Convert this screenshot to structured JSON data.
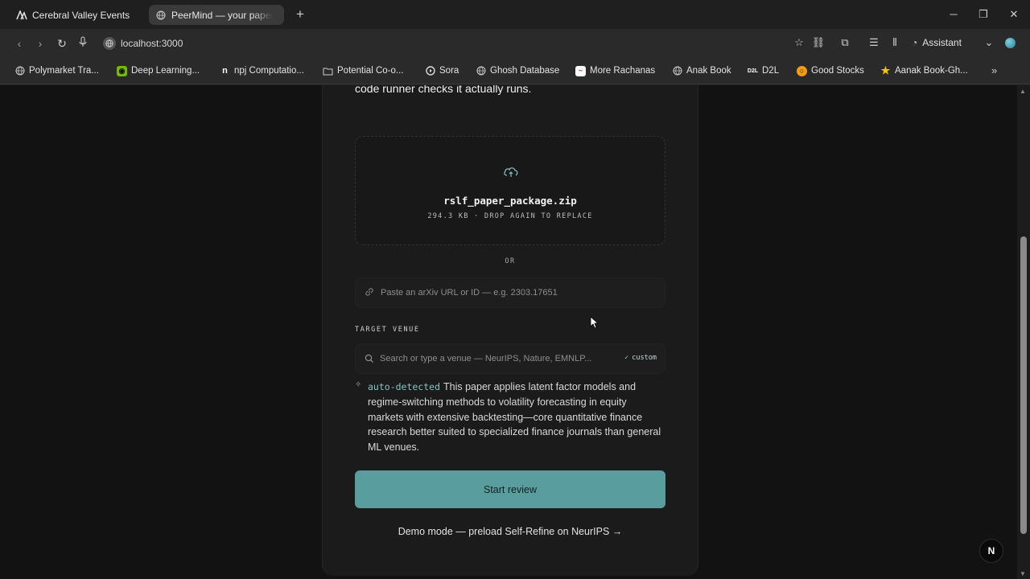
{
  "browser": {
    "tabs": [
      {
        "label": "Cerebral Valley Events",
        "icon": "cerebral-valley-icon"
      },
      {
        "label": "PeerMind — your paper's",
        "icon": "globe-icon"
      }
    ],
    "url": "localhost:3000",
    "assistant_label": "Assistant",
    "bookmarks": [
      {
        "label": "Polymarket Tra...",
        "icon": "globe-icon"
      },
      {
        "label": "Deep Learning...",
        "icon": "nvidia-icon"
      },
      {
        "label": "npj Computatio...",
        "icon": "n-icon"
      },
      {
        "label": "Potential Co-o...",
        "icon": "folder-icon"
      },
      {
        "label": "Sora",
        "icon": "sora-icon"
      },
      {
        "label": "Ghosh Database",
        "icon": "globe-icon"
      },
      {
        "label": "More Rachanas",
        "icon": "rachana-icon"
      },
      {
        "label": "Anak Book",
        "icon": "globe-icon"
      },
      {
        "label": "D2L",
        "icon": "d2l-icon"
      },
      {
        "label": "Good Stocks",
        "icon": "stocks-icon"
      },
      {
        "label": "Aanak Book-Gh...",
        "icon": "star-icon"
      }
    ]
  },
  "page": {
    "intro_tail": "code runner checks it actually runs.",
    "upload": {
      "file_name": "rslf_paper_package.zip",
      "file_meta": "294.3 KB · DROP AGAIN TO REPLACE"
    },
    "or_label": "OR",
    "arxiv": {
      "placeholder": "Paste an arXiv URL or ID — e.g. 2303.17651"
    },
    "venue": {
      "label": "TARGET VENUE",
      "placeholder": "Search or type a venue — NeurIPS, Nature, EMNLP...",
      "badge": "custom"
    },
    "detection": {
      "tag": "auto-detected",
      "text": "This paper applies latent factor models and regime-switching methods to volatility forecasting in equity markets with extensive backtesting—core quantitative finance research better suited to specialized finance journals than general ML venues."
    },
    "start_button": "Start review",
    "demo_link": "Demo mode — preload Self-Refine on NeurIPS →",
    "next_badge": "N"
  },
  "colors": {
    "accent": "#5a9d9f",
    "page_bg": "#121212",
    "card_bg": "#1b1b1b"
  }
}
